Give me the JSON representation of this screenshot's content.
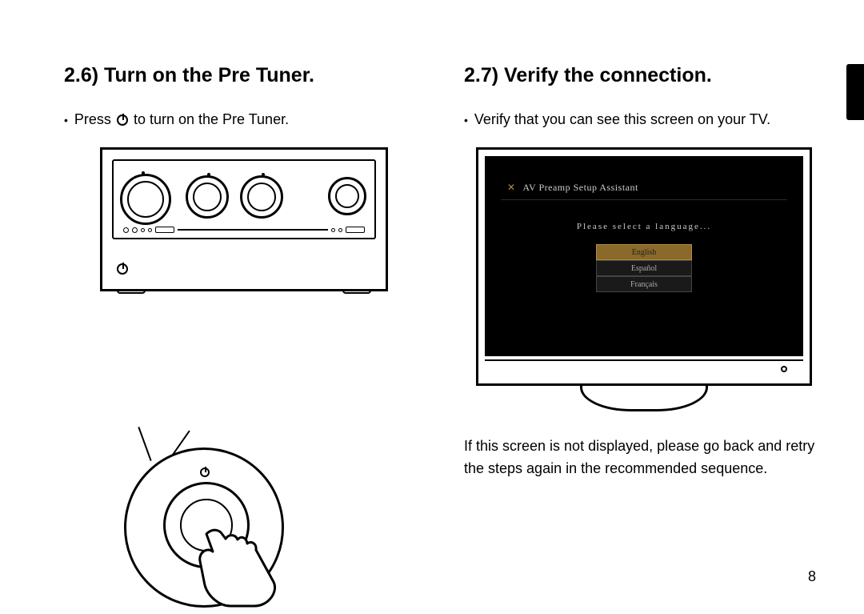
{
  "page_number": "8",
  "left": {
    "heading": "2.6) Turn on the Pre Tuner.",
    "bullet_pre": "Press",
    "bullet_post": "to turn on the Pre Tuner."
  },
  "right": {
    "heading": "2.7) Verify the connection.",
    "bullet": "Verify that you can see this screen on your TV.",
    "tv_header": "AV Preamp Setup Assistant",
    "tv_prompt": "Please select a language...",
    "languages": {
      "0": "English",
      "1": "Español",
      "2": "Français"
    },
    "note": "If this screen is not displayed, please go back and retry the steps again in the recommended sequence."
  }
}
